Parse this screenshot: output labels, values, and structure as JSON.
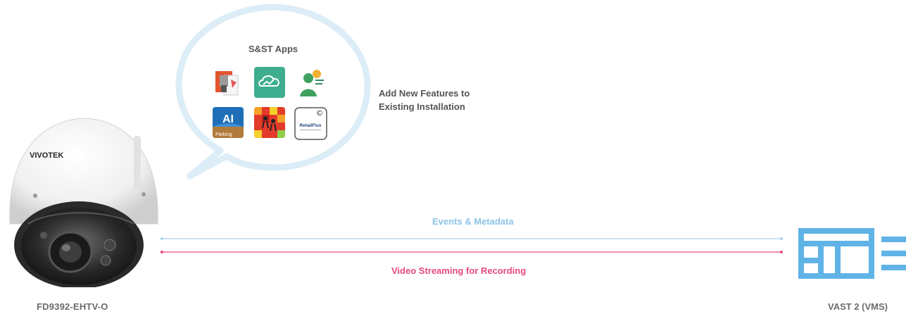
{
  "camera": {
    "model_label": "FD9392-EHTV-O",
    "brand_text": "VIVOTEK"
  },
  "apps_bubble": {
    "title": "S&ST Apps",
    "apps": [
      {
        "icon": "fire-extinguisher-app-icon"
      },
      {
        "icon": "cloud-graph-app-icon"
      },
      {
        "icon": "person-chart-app-icon"
      },
      {
        "icon": "ai-parking-app-icon",
        "text_main": "AI",
        "text_sub": "Parking"
      },
      {
        "icon": "heatmap-people-app-icon"
      },
      {
        "icon": "retailflux-app-icon",
        "text": "RetailFlux",
        "badge": "©"
      }
    ]
  },
  "features_text": {
    "line1": "Add New Features to",
    "line2": "Existing Installation"
  },
  "flows": {
    "events_label": "Events & Metadata",
    "events_color": "#9ccbe8",
    "video_label": "Video Streaming for Recording",
    "video_color": "#e8497a"
  },
  "vms": {
    "label": "VAST 2 (VMS)",
    "color": "#5fb3e6"
  }
}
